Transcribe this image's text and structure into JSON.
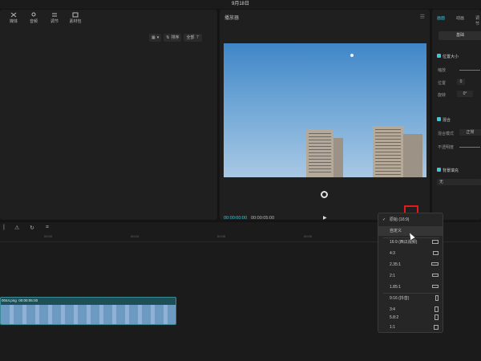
{
  "titlebar": {
    "date": "9月18日"
  },
  "media_toolbar": [
    {
      "label": "媒体",
      "icon": "media-icon"
    },
    {
      "label": "音频",
      "icon": "audio-icon"
    },
    {
      "label": "调节",
      "icon": "adjust-icon"
    },
    {
      "label": "素材包",
      "icon": "folder-icon"
    }
  ],
  "media_tools": {
    "sort": "排序",
    "filter": "全部"
  },
  "player": {
    "title": "播放器",
    "current_time": "00:00:00:00",
    "total_time": "00:00:05:00",
    "ratio_button": "比例"
  },
  "props": {
    "tabs": [
      "画面",
      "动画",
      "调节"
    ],
    "subtab": "基础",
    "position_size": "位置大小",
    "scale": "缩放",
    "position": "位置",
    "position_x": "0",
    "rotate": "旋转",
    "rotate_value": "0°",
    "blend": "混合",
    "blend_mode": "混合模式",
    "blend_mode_value": "正常",
    "opacity": "不透明度",
    "background": "背景填充",
    "background_value": "无"
  },
  "timeline": {
    "ticks": [
      "00:00",
      "00:03",
      "00:06",
      "00:09",
      "00:12"
    ],
    "clip_name": "0044.png",
    "clip_duration": "00:00:05:00"
  },
  "ratio_menu": {
    "items": [
      {
        "label": "原始 (16:9)",
        "checked": true,
        "shape": ""
      },
      {
        "label": "自定义",
        "checked": false,
        "shape": "",
        "hover": true
      },
      {
        "label": "16:9 (西瓜视频)",
        "checked": false,
        "shape": "wide"
      },
      {
        "label": "4:3",
        "checked": false,
        "shape": "wide"
      },
      {
        "label": "2.35:1",
        "checked": false,
        "shape": "wide"
      },
      {
        "label": "2:1",
        "checked": false,
        "shape": "wide"
      },
      {
        "label": "1.85:1",
        "checked": false,
        "shape": "wide"
      },
      {
        "label": "9:16 (抖音)",
        "checked": false,
        "shape": "tall"
      },
      {
        "label": "3:4",
        "checked": false,
        "shape": "tall"
      },
      {
        "label": "5.8:2",
        "checked": false,
        "shape": "tall"
      },
      {
        "label": "1:1",
        "checked": false,
        "shape": "square"
      }
    ]
  }
}
